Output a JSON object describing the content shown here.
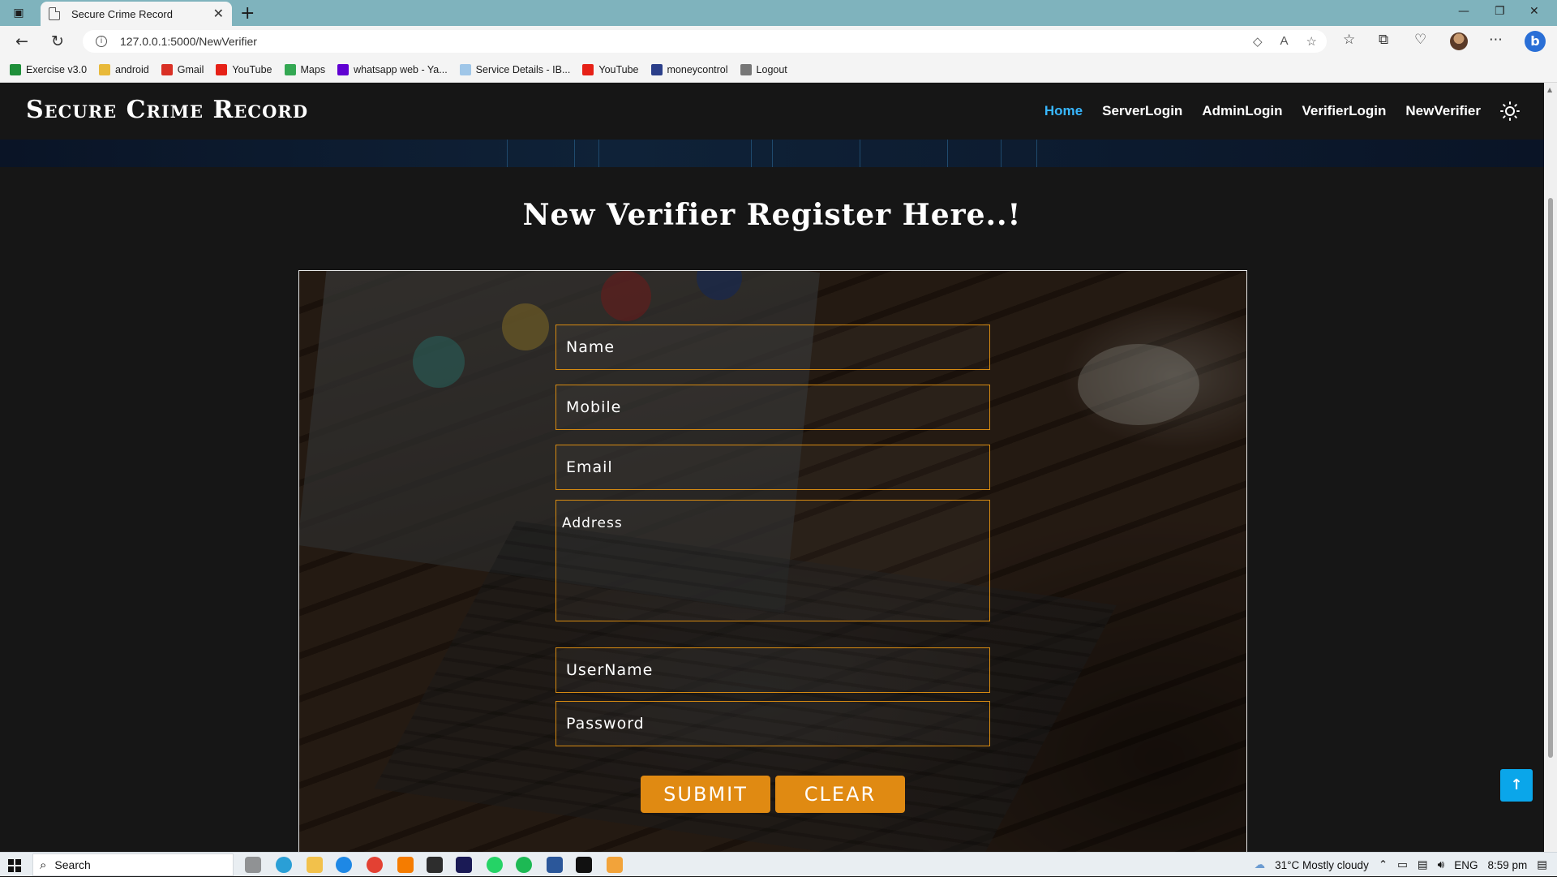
{
  "browser": {
    "tab_title": "Secure Crime Record",
    "url": "127.0.0.1:5000/NewVerifier",
    "bookmarks": [
      {
        "label": "Exercise v3.0",
        "icon": "w-icon",
        "color": "#1f8f3a"
      },
      {
        "label": "android",
        "icon": "folder-icon",
        "color": "#e8b93a"
      },
      {
        "label": "Gmail",
        "icon": "gmail-icon",
        "color": "#d93025"
      },
      {
        "label": "YouTube",
        "icon": "youtube-icon",
        "color": "#e62117"
      },
      {
        "label": "Maps",
        "icon": "maps-pin-icon",
        "color": "#34a853"
      },
      {
        "label": "whatsapp web - Ya...",
        "icon": "yahoo-icon",
        "color": "#6001d2"
      },
      {
        "label": "Service Details - IB...",
        "icon": "cloud-icon",
        "color": "#9fc6e8"
      },
      {
        "label": "YouTube",
        "icon": "youtube-icon",
        "color": "#e62117"
      },
      {
        "label": "moneycontrol",
        "icon": "moneycontrol-icon",
        "color": "#2b3f8a"
      },
      {
        "label": "Logout",
        "icon": "page-icon",
        "color": "#777777"
      }
    ]
  },
  "site": {
    "brand": "Secure Crime Record",
    "nav": [
      {
        "label": "Home",
        "active": true
      },
      {
        "label": "ServerLogin",
        "active": false
      },
      {
        "label": "AdminLogin",
        "active": false
      },
      {
        "label": "VerifierLogin",
        "active": false
      },
      {
        "label": "NewVerifier",
        "active": false
      }
    ],
    "accent": "#38b7ff"
  },
  "form": {
    "heading": "New Verifier Register Here..!",
    "fields": {
      "name": {
        "placeholder": "Name",
        "value": ""
      },
      "mobile": {
        "placeholder": "Mobile",
        "value": ""
      },
      "email": {
        "placeholder": "Email",
        "value": ""
      },
      "address": {
        "placeholder": "Address",
        "value": ""
      },
      "username": {
        "placeholder": "UserName",
        "value": ""
      },
      "password": {
        "placeholder": "Password",
        "value": ""
      }
    },
    "submit_label": "SUBMIT",
    "clear_label": "CLEAR",
    "button_color": "#e08a12",
    "border_color": "#d68a12"
  },
  "taskbar": {
    "search_label": "Search",
    "weather": "31°C  Mostly cloudy",
    "language": "ENG",
    "time": "8:59 pm"
  }
}
